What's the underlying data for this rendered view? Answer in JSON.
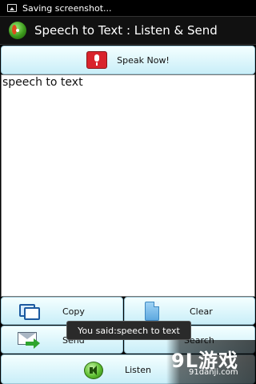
{
  "status_bar": {
    "notification": "Saving screenshot..."
  },
  "title_bar": {
    "title": "Speech to Text : Listen & Send"
  },
  "buttons": {
    "speak": "Speak Now!",
    "copy": "Copy",
    "clear": "Clear",
    "send": "Send",
    "search": "Search",
    "listen": "Listen"
  },
  "text_area": {
    "value": "speech to text"
  },
  "toast": {
    "message": "You said:speech to text"
  },
  "watermark": {
    "logo": "9L游戏",
    "url": "91danji.com"
  },
  "colors": {
    "button_top": "#f4ffff",
    "button_bottom": "#c9eef8",
    "title_bar_bg": "#111111",
    "mic_red": "#d9232b"
  },
  "icons": [
    "image-icon",
    "app-icon",
    "microphone-icon",
    "copy-icon",
    "clear-icon",
    "send-icon",
    "speaker-icon"
  ]
}
